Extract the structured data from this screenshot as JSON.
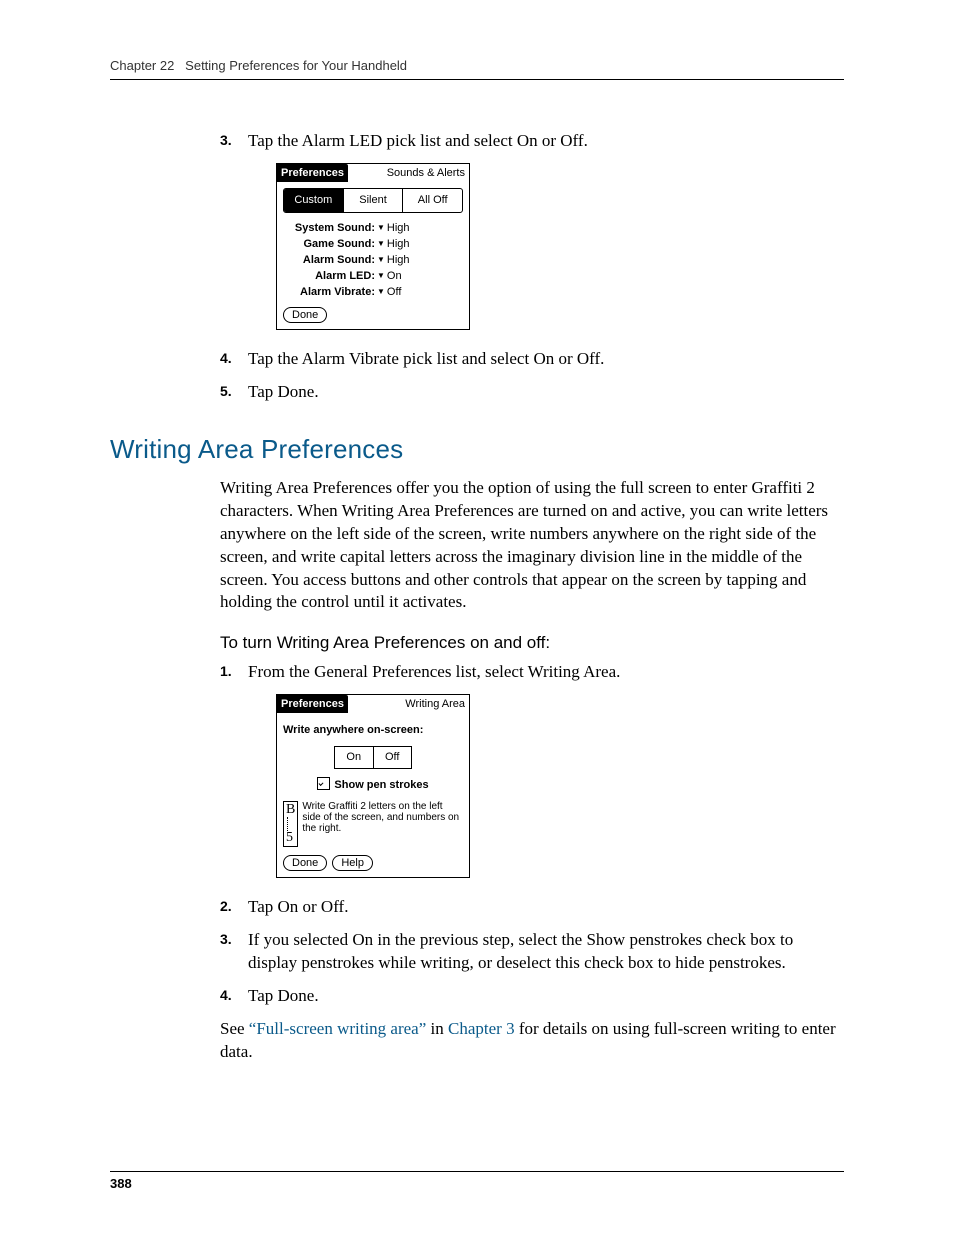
{
  "header": {
    "chapter": "Chapter 22",
    "title": "Setting Preferences for Your Handheld"
  },
  "stepsA": {
    "s3": {
      "num": "3.",
      "text": "Tap the Alarm LED pick list and select On or Off."
    },
    "s4": {
      "num": "4.",
      "text": "Tap the Alarm Vibrate pick list and select On or Off."
    },
    "s5": {
      "num": "5.",
      "text": "Tap Done."
    }
  },
  "palm1": {
    "titleLeft": "Preferences",
    "titleRight": "Sounds & Alerts",
    "tabs": {
      "t1": "Custom",
      "t2": "Silent",
      "t3": "All Off"
    },
    "rows": {
      "r1": {
        "label": "System Sound:",
        "value": "High"
      },
      "r2": {
        "label": "Game Sound:",
        "value": "High"
      },
      "r3": {
        "label": "Alarm Sound:",
        "value": "High"
      },
      "r4": {
        "label": "Alarm LED:",
        "value": "On"
      },
      "r5": {
        "label": "Alarm Vibrate:",
        "value": "Off"
      }
    },
    "done": "Done"
  },
  "sectionTitle": "Writing Area Preferences",
  "sectionBody": "Writing Area Preferences offer you the option of using the full screen to enter Graffiti 2 characters. When Writing Area Preferences are turned on and active, you can write letters anywhere on the left side of the screen, write numbers anywhere on the right side of the screen, and write capital letters across the imaginary division line in the middle of the screen. You access buttons and other controls that appear on the screen by tapping and holding the control until it activates.",
  "subhead": "To turn Writing Area Preferences on and off:",
  "stepsB": {
    "s1": {
      "num": "1.",
      "text": "From the General Preferences list, select Writing Area."
    },
    "s2": {
      "num": "2.",
      "text": "Tap On or Off."
    },
    "s3": {
      "num": "3.",
      "text": "If you selected On in the previous step, select the Show penstrokes check box to display penstrokes while writing, or deselect this check box to hide penstrokes."
    },
    "s4": {
      "num": "4.",
      "text": "Tap Done."
    }
  },
  "palm2": {
    "titleLeft": "Preferences",
    "titleRight": "Writing Area",
    "prompt": "Write anywhere on-screen:",
    "on": "On",
    "off": "Off",
    "checkbox": "Show pen strokes",
    "glyphB": "B",
    "glyph5": "5",
    "hint": "Write Graffiti 2 letters on the left side of the screen, and numbers on the right.",
    "done": "Done",
    "help": "Help"
  },
  "seeAlso": {
    "pre": "See ",
    "link1": "“Full-screen writing area”",
    "mid": " in ",
    "link2": "Chapter 3",
    "post": " for details on using full-screen writing to enter data."
  },
  "pageNumber": "388"
}
